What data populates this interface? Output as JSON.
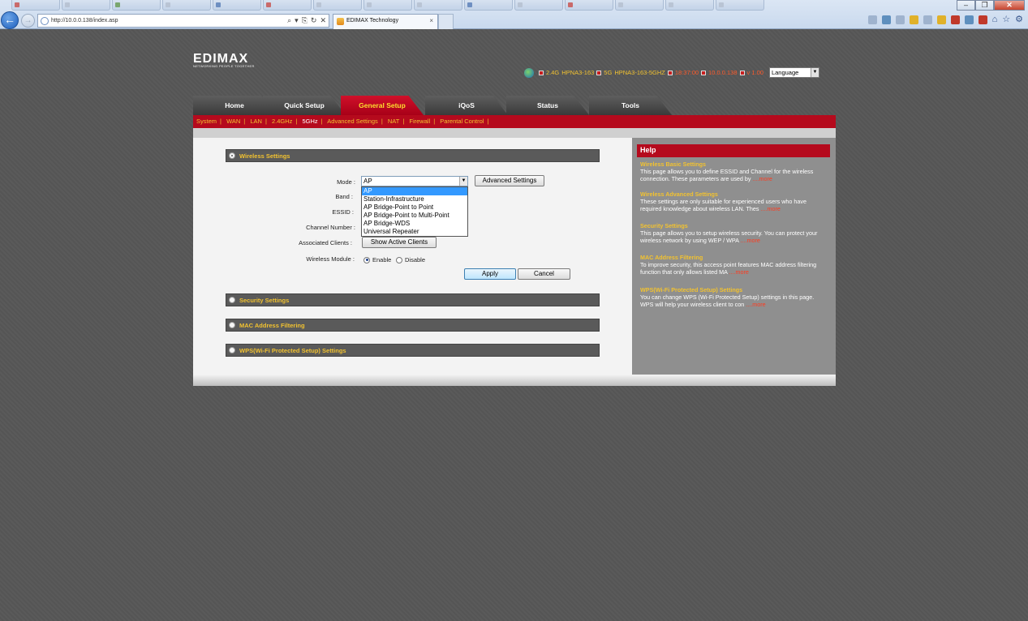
{
  "browser": {
    "ghost_tabs": [
      "",
      "",
      "",
      "",
      "",
      "",
      "",
      "",
      "",
      "",
      "",
      "",
      "",
      "",
      ""
    ],
    "address": "http://10.0.0.138/index.asp",
    "tab_title": "EDIMAX Technology",
    "tab_close": "×",
    "back": "←",
    "forward": "→",
    "win_min": "–",
    "win_max": "❐",
    "win_close": "✕",
    "addr_tools": [
      "⌕",
      "▾",
      "⎘",
      "↻",
      "✕"
    ]
  },
  "logo": {
    "brand": "EDIMAX",
    "slogan": "NETWORKING PEOPLE TOGETHER"
  },
  "status": {
    "ssid24_label": "2.4G",
    "ssid24": "HPNA3-163",
    "ssid5_label": "5G",
    "ssid5": "HPNA3-163-5GHZ",
    "time": "18:37:00",
    "ip": "10.0.0.138",
    "version": "v 1.00",
    "language": "Language"
  },
  "nav": {
    "tabs": [
      "Home",
      "Quick Setup",
      "General Setup",
      "iQoS",
      "Status",
      "Tools"
    ],
    "active_index": 2
  },
  "subnav": {
    "items": [
      "System",
      "WAN",
      "LAN",
      "2.4GHz",
      "5GHz",
      "Advanced Settings",
      "NAT",
      "Firewall",
      "Parental Control"
    ],
    "current": "5GHz"
  },
  "sections": {
    "wireless": "Wireless Settings",
    "security": "Security Settings",
    "mac": "MAC Address Filtering",
    "wps": "WPS(Wi-Fi Protected Setup) Settings"
  },
  "form": {
    "mode_label": "Mode :",
    "band_label": "Band :",
    "essid_label": "ESSID :",
    "channel_label": "Channel Number :",
    "clients_label": "Associated Clients :",
    "module_label": "Wireless Module :",
    "mode_value": "AP",
    "mode_options": [
      "AP",
      "Station-Infrastructure",
      "AP Bridge-Point to Point",
      "AP Bridge-Point to Multi-Point",
      "AP Bridge-WDS",
      "Universal Repeater"
    ],
    "advanced_button": "Advanced Settings",
    "clients_button": "Show Active Clients",
    "enable": "Enable",
    "disable": "Disable",
    "module_state": "Enable",
    "apply": "Apply",
    "cancel": "Cancel"
  },
  "help": {
    "title": "Help",
    "items": [
      {
        "heading": "Wireless Basic Settings",
        "text": "This page allows you to define ESSID and Channel for the wireless connection. These parameters are used by",
        "more": "....more"
      },
      {
        "heading": "Wireless Advanced Settings",
        "text": "These settings are only suitable for experienced users who have required knowledge about wireless LAN. Thes",
        "more": "....more"
      },
      {
        "heading": "Security Settings",
        "text": "This page allows you to setup wireless security. You can protect your wireless network by using WEP / WPA",
        "more": "....more"
      },
      {
        "heading": "MAC Address Filtering",
        "text": "To improve security, this access point features MAC address filtering function that only allows listed MA",
        "more": "....more"
      },
      {
        "heading": "WPS(Wi-Fi Protected Setup) Settings",
        "text": "You can change WPS (Wi-Fi Protected Setup) settings in this page. WPS will help your wireless client to con",
        "more": "....more"
      }
    ]
  }
}
